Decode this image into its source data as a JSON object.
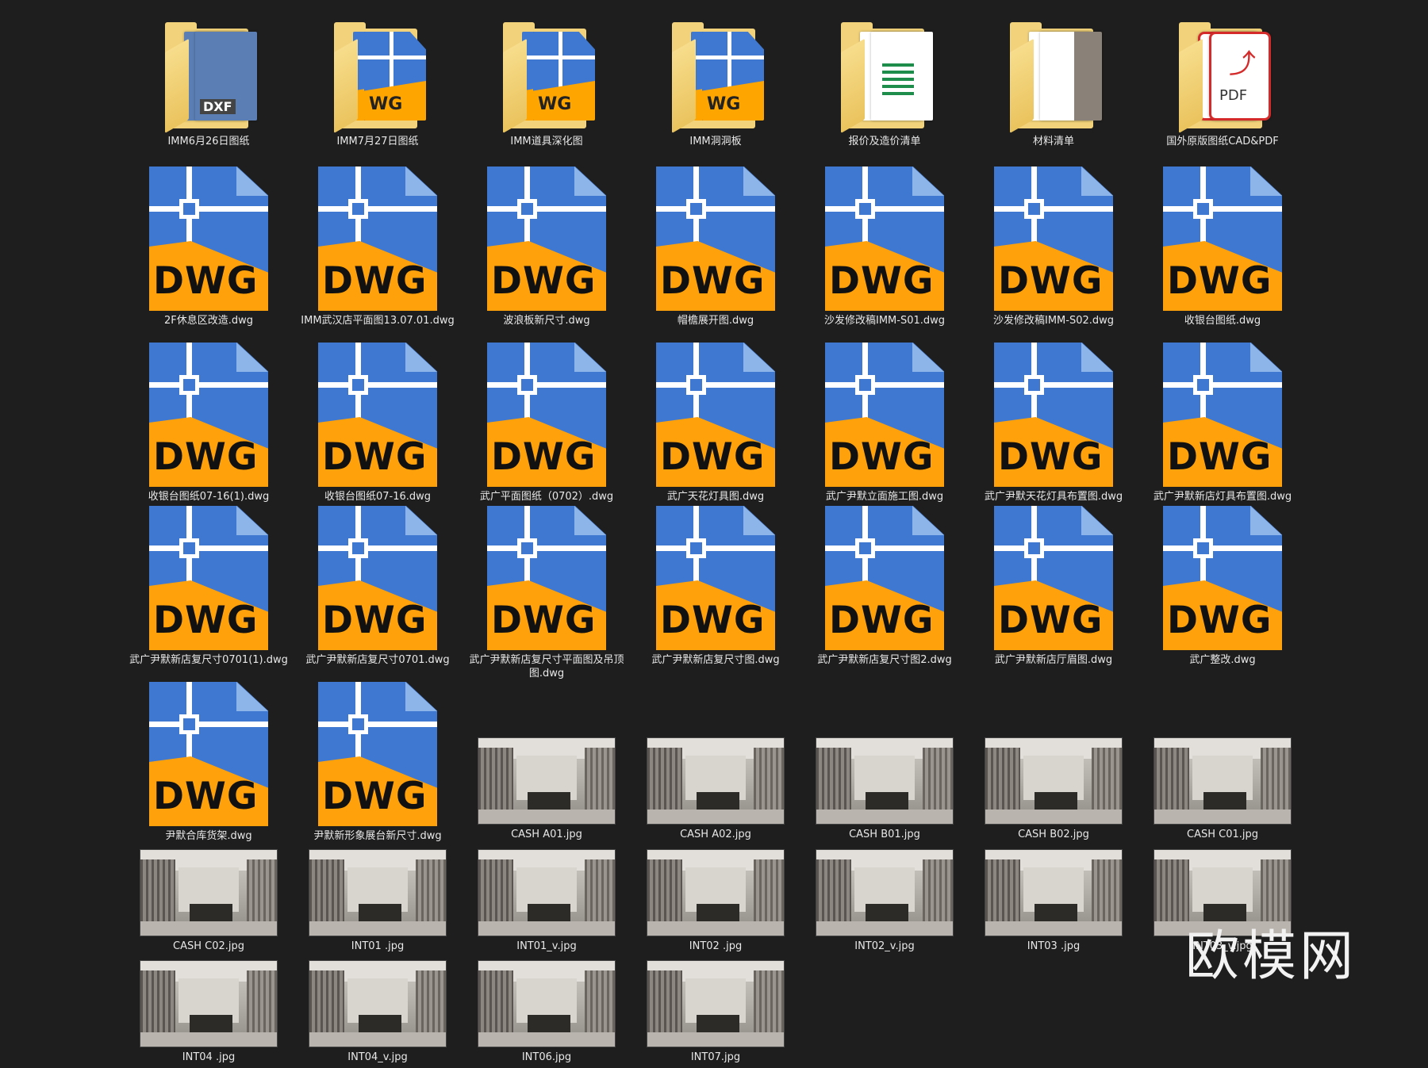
{
  "folders": [
    {
      "label": "IMM6月26日图纸",
      "icon": "dxf-folder-icon",
      "badge": "DXF"
    },
    {
      "label": "IMM7月27日图纸",
      "icon": "dwg-folder-icon",
      "badge": "WG"
    },
    {
      "label": "IMM道具深化图",
      "icon": "dwg-folder-icon",
      "badge": "WG"
    },
    {
      "label": "IMM洞洞板",
      "icon": "dwg-folder-icon",
      "badge": "WG"
    },
    {
      "label": "报价及造价清单",
      "icon": "excel-folder-icon",
      "badge": ""
    },
    {
      "label": "材料清单",
      "icon": "material-folder-icon",
      "badge": ""
    },
    {
      "label": "国外原版图纸CAD&PDF",
      "icon": "pdf-folder-icon",
      "badge": "PDF"
    }
  ],
  "dwg_badge": "DWG",
  "dwg_files": [
    "2F休息区改造.dwg",
    "IMM武汉店平面图13.07.01.dwg",
    "波浪板新尺寸.dwg",
    "帽檐展开图.dwg",
    "沙发修改稿IMM-S01.dwg",
    "沙发修改稿IMM-S02.dwg",
    "收银台图纸.dwg",
    "收银台图纸07-16(1).dwg",
    "收银台图纸07-16.dwg",
    "武广平面图纸（0702）.dwg",
    "武广天花灯具图.dwg",
    "武广尹默立面施工图.dwg",
    "武广尹默天花灯具布置图.dwg",
    "武广尹默新店灯具布置图.dwg",
    "武广尹默新店复尺寸0701(1).dwg",
    "武广尹默新店复尺寸0701.dwg",
    "武广尹默新店复尺寸平面图及吊顶图.dwg",
    "武广尹默新店复尺寸图.dwg",
    "武广尹默新店复尺寸图2.dwg",
    "武广尹默新店厅眉图.dwg",
    "武广整改.dwg",
    "尹默合库货架.dwg",
    "尹默新形象展台新尺寸.dwg"
  ],
  "images": [
    "CASH A01.jpg",
    "CASH A02.jpg",
    "CASH B01.jpg",
    "CASH B02.jpg",
    "CASH C01.jpg",
    "CASH C02.jpg",
    "INT01 .jpg",
    "INT01_v.jpg",
    "INT02 .jpg",
    "INT02_v.jpg",
    "INT03 .jpg",
    "INT03_v.jpg",
    "INT04 .jpg",
    "INT04_v.jpg",
    "INT06.jpg",
    "INT07.jpg"
  ],
  "watermark": "欧模网"
}
